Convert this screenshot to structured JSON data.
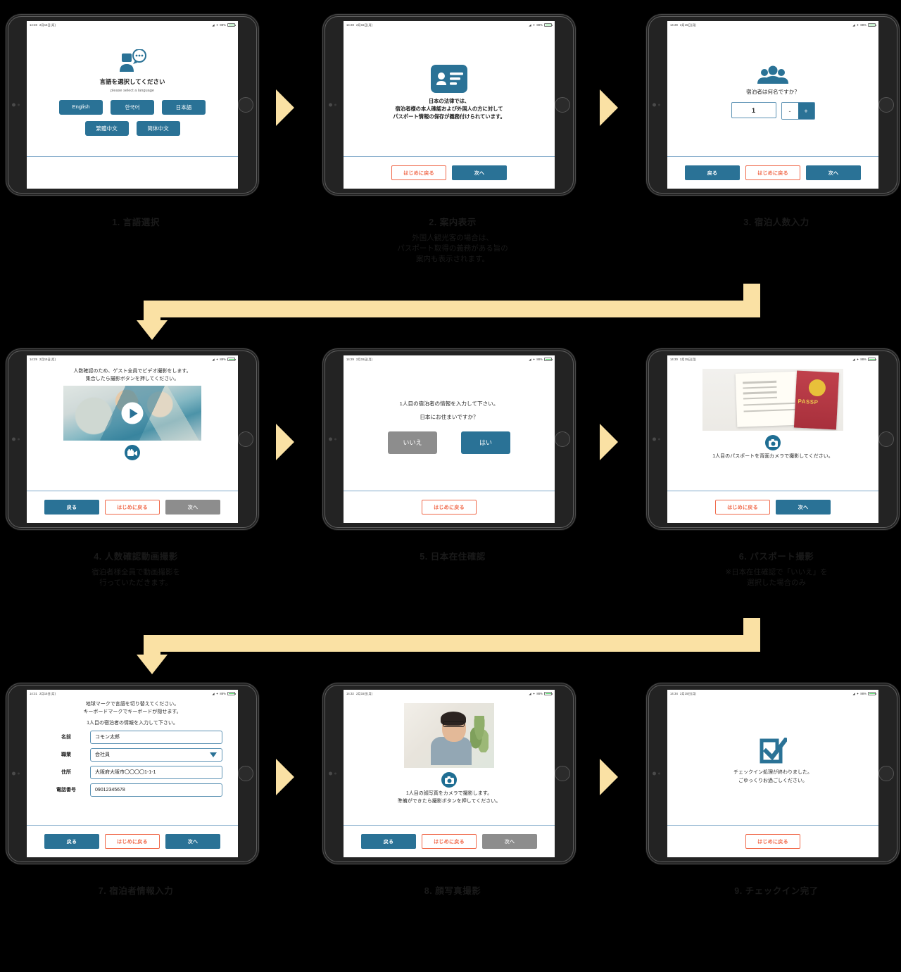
{
  "statusbar": {
    "time_1": "14:28",
    "date_1": "2月15日(月)",
    "time_2": "14:28",
    "date_2": "2月15日(月)",
    "time_3": "14:29",
    "date_3": "2月15日(月)",
    "time_4": "14:29",
    "date_4": "2月15日(月)",
    "time_5": "14:29",
    "date_5": "2月15日(月)",
    "time_6": "14:30",
    "date_6": "2月15日(月)",
    "time_7": "14:31",
    "date_7": "2月15日(月)",
    "time_8": "14:32",
    "date_8": "2月15日(月)",
    "time_9": "14:34",
    "date_9": "2月15日(月)",
    "battery": "88%"
  },
  "colors": {
    "accent_blue": "#2a7296",
    "ghost_orange": "#f0694a",
    "disabled_gray": "#8d8d8d",
    "arrow_cream": "#fae1a4",
    "divider_blue": "#7fa8c9"
  },
  "buttons": {
    "back": "戻る",
    "restart": "はじめに戻る",
    "next": "次へ"
  },
  "steps": [
    {
      "num": "1",
      "caption": "1. 言語選択",
      "note": "",
      "screen": {
        "icon": "person-speech-bubble-icon",
        "title": "言語を選択してください",
        "subtitle": "please select a language",
        "languages_row1": [
          "English",
          "한국어",
          "日本語"
        ],
        "languages_row2": [
          "繁體中文",
          "简体中文"
        ]
      }
    },
    {
      "num": "2",
      "caption": "2. 案内表示",
      "note": "外国人観光客の場合は、\nパスポート取得の義務がある旨の\n案内も表示されます。",
      "screen": {
        "icon": "id-card-icon",
        "line1": "日本の法律では、",
        "line2": "宿泊者様の本人確認および外国人の方に対して",
        "line3": "パスポート情報の保存が義務付けられています。"
      }
    },
    {
      "num": "3",
      "caption": "3. 宿泊人数入力",
      "note": "",
      "screen": {
        "icon": "group-people-icon",
        "question": "宿泊者は何名ですか？",
        "count_value": "1",
        "minus_label": "-",
        "plus_label": "+"
      }
    },
    {
      "num": "4",
      "caption": "4. 人数確認動画撮影",
      "note": "宿泊者様全員で動画撮影を\n行っていただきます。",
      "screen": {
        "line1": "人数確認のため、ゲスト全員でビデオ撮影をします。",
        "line2": "集合したら撮影ボタンを押してください。",
        "media": "group-photo-preview",
        "play_icon": "play-icon",
        "capture_icon": "video-camera-icon"
      }
    },
    {
      "num": "5",
      "caption": "5. 日本在住確認",
      "note": "",
      "screen": {
        "line1": "1人目の宿泊者の情報を入力して下さい。",
        "line2": "日本にお住まいですか？",
        "no_label": "いいえ",
        "yes_label": "はい"
      }
    },
    {
      "num": "6",
      "caption": "6. パスポート撮影",
      "note": "※日本在住確認で「いいえ」を\n選択した場合のみ",
      "screen": {
        "media": "passport-photo-preview",
        "passport_text": "PASSP",
        "capture_icon": "camera-icon",
        "instruction": "1人目のパスポートを背面カメラで撮影してください。"
      }
    },
    {
      "num": "7",
      "caption": "7. 宿泊者情報入力",
      "note": "",
      "screen": {
        "hint1": "地球マークで言語を切り替えてください。",
        "hint2": "キーボードマークでキーボードが隠せます。",
        "prompt": "1人目の宿泊者の情報を入力して下さい。",
        "fields": [
          {
            "label": "名前",
            "value": "コモン太郎",
            "type": "text"
          },
          {
            "label": "職業",
            "value": "会社員",
            "type": "select"
          },
          {
            "label": "住所",
            "value": "大阪府大阪市〇〇〇〇1-1-1",
            "type": "text"
          },
          {
            "label": "電話番号",
            "value": "09012345678",
            "type": "text"
          }
        ]
      }
    },
    {
      "num": "8",
      "caption": "8. 顔写真撮影",
      "note": "",
      "screen": {
        "media": "face-photo-preview",
        "capture_icon": "camera-icon",
        "line1": "1人目の顔写真をカメラで撮影します。",
        "line2": "準備ができたら撮影ボタンを押してください。"
      }
    },
    {
      "num": "9",
      "caption": "9. チェックイン完了",
      "note": "",
      "screen": {
        "icon": "checkbox-check-icon",
        "line1": "チェックイン処理が終わりました。",
        "line2": "ごゆっくりお過ごしください。"
      }
    }
  ]
}
